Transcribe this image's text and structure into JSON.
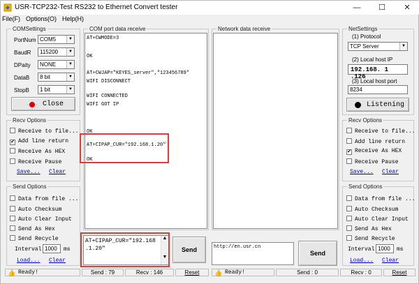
{
  "window": {
    "title": "USR-TCP232-Test  RS232 to Ethernet Convert tester",
    "min": "—",
    "max": "☐",
    "close": "✕"
  },
  "menu": [
    "File(F)",
    "Options(O)",
    "Help(H)"
  ],
  "com_settings": {
    "legend": "COMSettings",
    "portnum_label": "PortNum",
    "portnum_value": "COM5",
    "baudr_label": "BaudR",
    "baudr_value": "115200",
    "dparity_label": "DPaity",
    "dparity_value": "NONE",
    "datab_label": "DataB",
    "datab_value": "8 bit",
    "stopb_label": "StopB",
    "stopb_value": "1 bit",
    "close_button": "Close"
  },
  "recv_options_left": {
    "legend": "Recv Options",
    "receive_to_file": "Receive to file...",
    "add_line_return": "Add line return",
    "receive_as_hex": "Receive As HEX",
    "receive_pause": "Receive Pause",
    "save": "Save...",
    "clear": "Clear"
  },
  "send_options_left": {
    "legend": "Send Options",
    "data_from_file": "Data from file ...",
    "auto_checksum": "Auto Checksum",
    "auto_clear_input": "Auto Clear Input",
    "send_as_hex": "Send As Hex",
    "send_recycle": "Send Recycle",
    "interval_label": "Interval",
    "interval_value": "1000",
    "interval_unit": "ms",
    "load": "Load...",
    "clear": "Clear"
  },
  "com_receive": {
    "legend": "COM port data receive",
    "lines": [
      "AT+CWMODE=3",
      "",
      "OK",
      "",
      "AT+CWJAP=\"KEYES_server\",\"123456789\"",
      "WIFI DISCONNECT",
      "",
      "WIFI CONNECTED",
      "WIFI GOT IP",
      "",
      "",
      "",
      "OK",
      "",
      "AT+CIPAP_CUR=\"192.168.1.20\"",
      "",
      "OK"
    ]
  },
  "net_receive": {
    "legend": "Network data receive"
  },
  "com_send": {
    "text": "AT+CIPAP_CUR=\"192.168\n.1.20\"",
    "send_button": "Send"
  },
  "net_send": {
    "text": "http://en.usr.cn",
    "send_button": "Send"
  },
  "net_settings": {
    "legend": "NetSettings",
    "protocol_label": "(1) Protocol",
    "protocol_value": "TCP Server",
    "local_ip_label": "(2) Local host IP",
    "local_ip_value": "192.168. 1 .126",
    "local_port_label": "(3) Local host port",
    "local_port_value": "8234",
    "listening_button": "Listening"
  },
  "recv_options_right": {
    "legend": "Recv Options",
    "receive_to_file": "Receive to file...",
    "add_line_return": "Add line return",
    "receive_as_hex": "Receive As HEX",
    "receive_pause": "Receive Pause",
    "save": "Save...",
    "clear": "Clear"
  },
  "send_options_right": {
    "legend": "Send Options",
    "data_from_file": "Data from file ...",
    "auto_checksum": "Auto Checksum",
    "auto_clear_input": "Auto Clear Input",
    "send_as_hex": "Send As Hex",
    "send_recycle": "Send Recycle",
    "interval_label": "Interval",
    "interval_value": "1000",
    "interval_unit": "ms",
    "load": "Load...",
    "clear": "Clear"
  },
  "status_left": {
    "ready": "Ready!",
    "send": "Send : 79",
    "recv": "Recv : 146",
    "reset": "Reset"
  },
  "status_right": {
    "ready": "Ready!",
    "send": "Send : 0",
    "recv": "Recv : 0",
    "reset": "Reset"
  },
  "colors": {
    "highlight": "#e03c3c",
    "link": "#0000cc",
    "red_dot": "#e00000"
  }
}
